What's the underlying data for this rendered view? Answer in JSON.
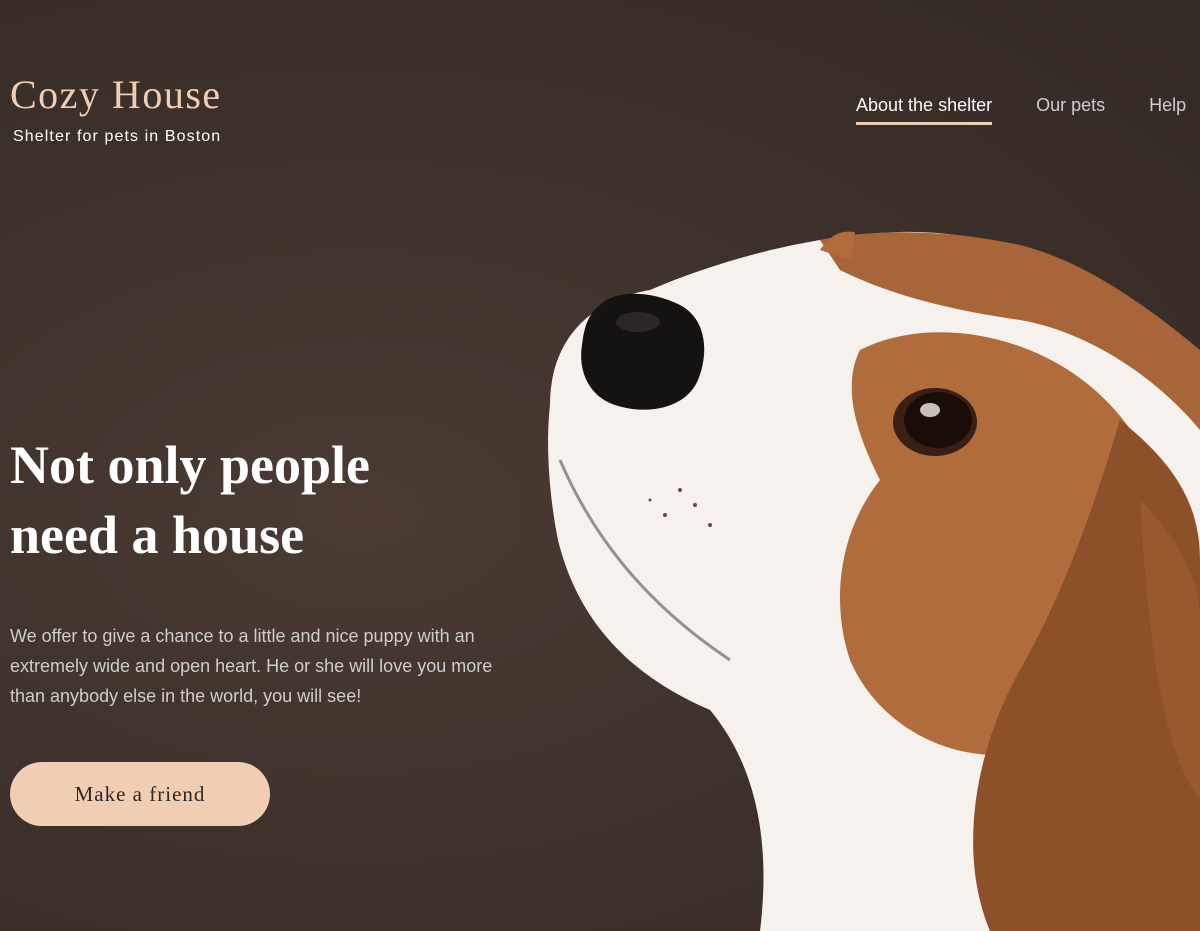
{
  "header": {
    "logo_title": "Cozy House",
    "logo_subtitle": "Shelter for pets in Boston",
    "nav": [
      {
        "label": "About the shelter",
        "active": true
      },
      {
        "label": "Our pets",
        "active": false
      },
      {
        "label": "Help",
        "active": false
      }
    ]
  },
  "hero": {
    "title_line1": "Not only people",
    "title_line2": "need a house",
    "text": "We offer to give a chance to a little and nice puppy with an extremely wide and open heart. He or she will love you more than anybody else in the world, you will see!",
    "cta_label": "Make a friend",
    "image": "beagle-puppy-photo"
  },
  "colors": {
    "accent": "#f1cdb3",
    "background": "#3f322c",
    "text_light": "#cdcdcd",
    "heading": "#ffffff"
  }
}
